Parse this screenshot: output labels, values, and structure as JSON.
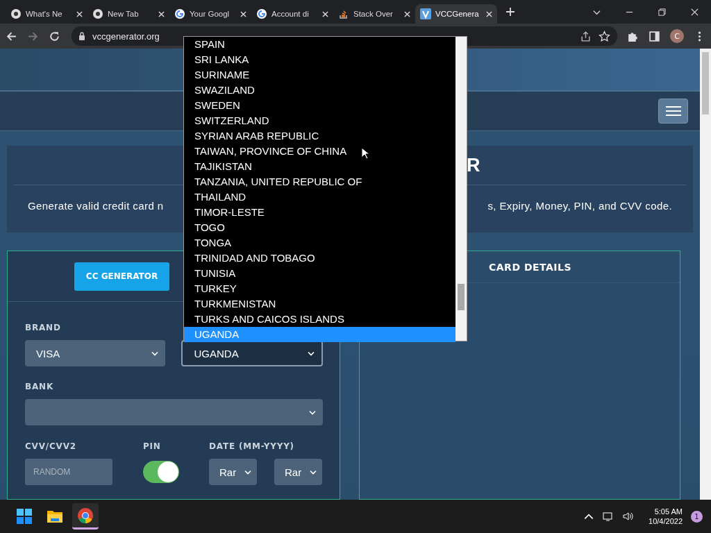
{
  "browser": {
    "tabs": [
      {
        "title": "What's Ne",
        "selected": false
      },
      {
        "title": "New Tab",
        "selected": false
      },
      {
        "title": "Your Googl",
        "selected": false
      },
      {
        "title": "Account di",
        "selected": false
      },
      {
        "title": "Stack Over",
        "selected": false
      },
      {
        "title": "VCCGenera",
        "selected": true
      }
    ],
    "url": "vccgenerator.org",
    "profile_initial": "C"
  },
  "page": {
    "title_fragment": "R",
    "description_start": "Generate valid credit card n",
    "description_end": "s, Expiry, Money, PIN, and CVV code.",
    "generator_button": "CC GENERATOR",
    "brand": {
      "label": "BRAND",
      "value": "VISA"
    },
    "country": {
      "value": "UGANDA"
    },
    "bank": {
      "label": "BANK"
    },
    "cvv": {
      "label": "CVV/CVV2",
      "placeholder": "RANDOM"
    },
    "pin": {
      "label": "PIN",
      "on": true
    },
    "date": {
      "label": "DATE (MM-YYYY)",
      "month": "Rar",
      "year": "Rar"
    },
    "card_details": {
      "title": "CARD DETAILS"
    }
  },
  "country_dropdown": {
    "options": [
      {
        "label": "SPAIN",
        "selected": false
      },
      {
        "label": "SRI LANKA",
        "selected": false
      },
      {
        "label": "SURINAME",
        "selected": false
      },
      {
        "label": "SWAZILAND",
        "selected": false
      },
      {
        "label": "SWEDEN",
        "selected": false
      },
      {
        "label": "SWITZERLAND",
        "selected": false
      },
      {
        "label": "SYRIAN ARAB REPUBLIC",
        "selected": false
      },
      {
        "label": "TAIWAN, PROVINCE OF CHINA",
        "selected": false
      },
      {
        "label": "TAJIKISTAN",
        "selected": false
      },
      {
        "label": "TANZANIA, UNITED REPUBLIC OF",
        "selected": false
      },
      {
        "label": "THAILAND",
        "selected": false
      },
      {
        "label": "TIMOR-LESTE",
        "selected": false
      },
      {
        "label": "TOGO",
        "selected": false
      },
      {
        "label": "TONGA",
        "selected": false
      },
      {
        "label": "TRINIDAD AND TOBAGO",
        "selected": false
      },
      {
        "label": "TUNISIA",
        "selected": false
      },
      {
        "label": "TURKEY",
        "selected": false
      },
      {
        "label": "TURKMENISTAN",
        "selected": false
      },
      {
        "label": "TURKS AND CAICOS ISLANDS",
        "selected": false
      },
      {
        "label": "UGANDA",
        "selected": true
      }
    ]
  },
  "taskbar": {
    "apps": [
      {
        "selected": false
      },
      {
        "selected": false
      },
      {
        "selected": true
      }
    ],
    "time": "5:05 AM",
    "date": "10/4/2022",
    "notifications": "1"
  }
}
